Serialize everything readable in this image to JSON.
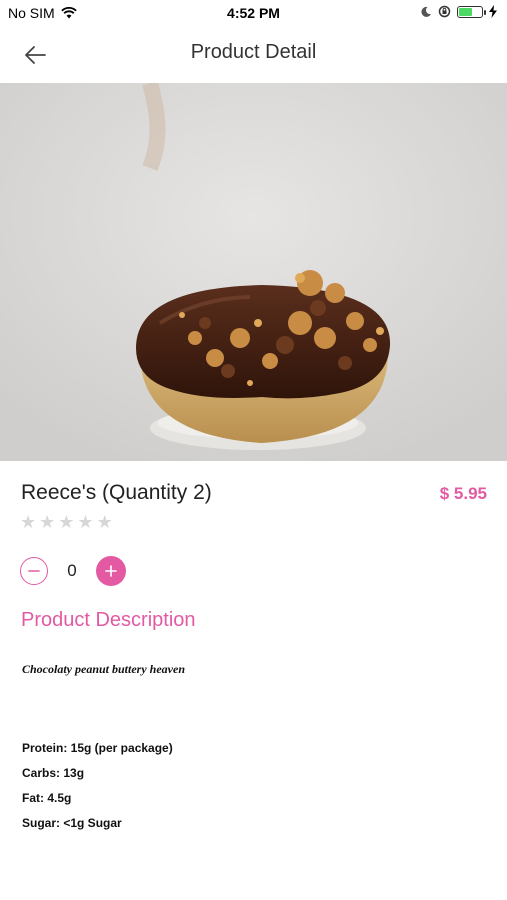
{
  "status_bar": {
    "carrier": "No SIM",
    "time": "4:52 PM",
    "battery_level": 0.55,
    "battery_color": "#4cd964",
    "icons": [
      "wifi-icon",
      "moon-icon",
      "rotation-lock-icon",
      "battery-icon",
      "charging-icon"
    ]
  },
  "nav": {
    "title": "Product Detail",
    "back_icon": "arrow-left-icon"
  },
  "product": {
    "name": "Reece's (Quantity 2)",
    "price": "$ 5.95",
    "rating": 0,
    "rating_max": 5,
    "quantity": "0",
    "image": "chocolate-peanut-butter-donut-photo"
  },
  "description": {
    "heading": "Product Description",
    "tagline": "Chocolaty peanut buttery heaven",
    "nutrition": [
      "Protein: 15g (per package)",
      "Carbs: 13g",
      "Fat: 4.5g",
      "Sugar: <1g Sugar"
    ]
  },
  "colors": {
    "accent": "#e35aa3",
    "star_empty": "#d7d7d7"
  }
}
